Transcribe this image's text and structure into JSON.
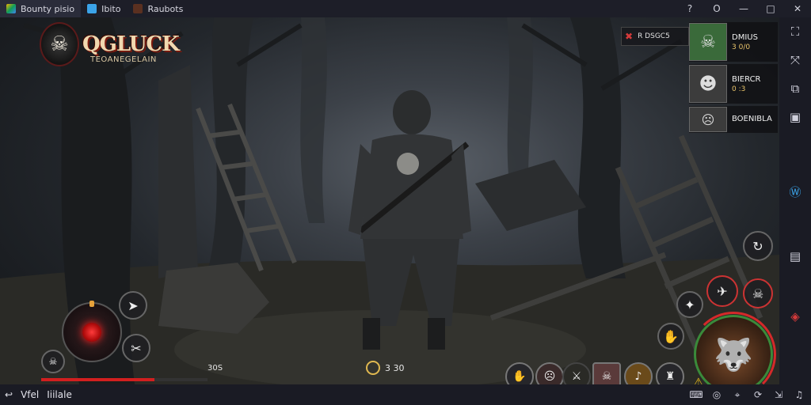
{
  "titlebar": {
    "tabs": [
      {
        "label": "Bounty pisio"
      },
      {
        "label": "Ibito"
      },
      {
        "label": "Raubots"
      }
    ],
    "controls": {
      "help": "?",
      "settings": "O",
      "minimize": "—",
      "maximize": "□",
      "close": "✕"
    }
  },
  "game": {
    "logo": {
      "name": "QGLUCK",
      "subtitle": "TEOANEGELAIN"
    },
    "top_info": {
      "text": "R DSGC5"
    },
    "players": [
      {
        "name": "DMIUS",
        "status": "3 0/0"
      },
      {
        "name": "BIERCR",
        "status": "0 :3"
      },
      {
        "name": "BOENIBLA"
      }
    ],
    "hp": {
      "label": "30S",
      "fraction": 0.68
    },
    "ammo": {
      "label": "3 30"
    }
  },
  "bottombar": {
    "label_a": "Vfel",
    "label_b": "Iiilale"
  },
  "colors": {
    "accent_red": "#d21f1f",
    "titlebar_bg": "#1d1e28",
    "health_ring": "#3a8a3a"
  }
}
